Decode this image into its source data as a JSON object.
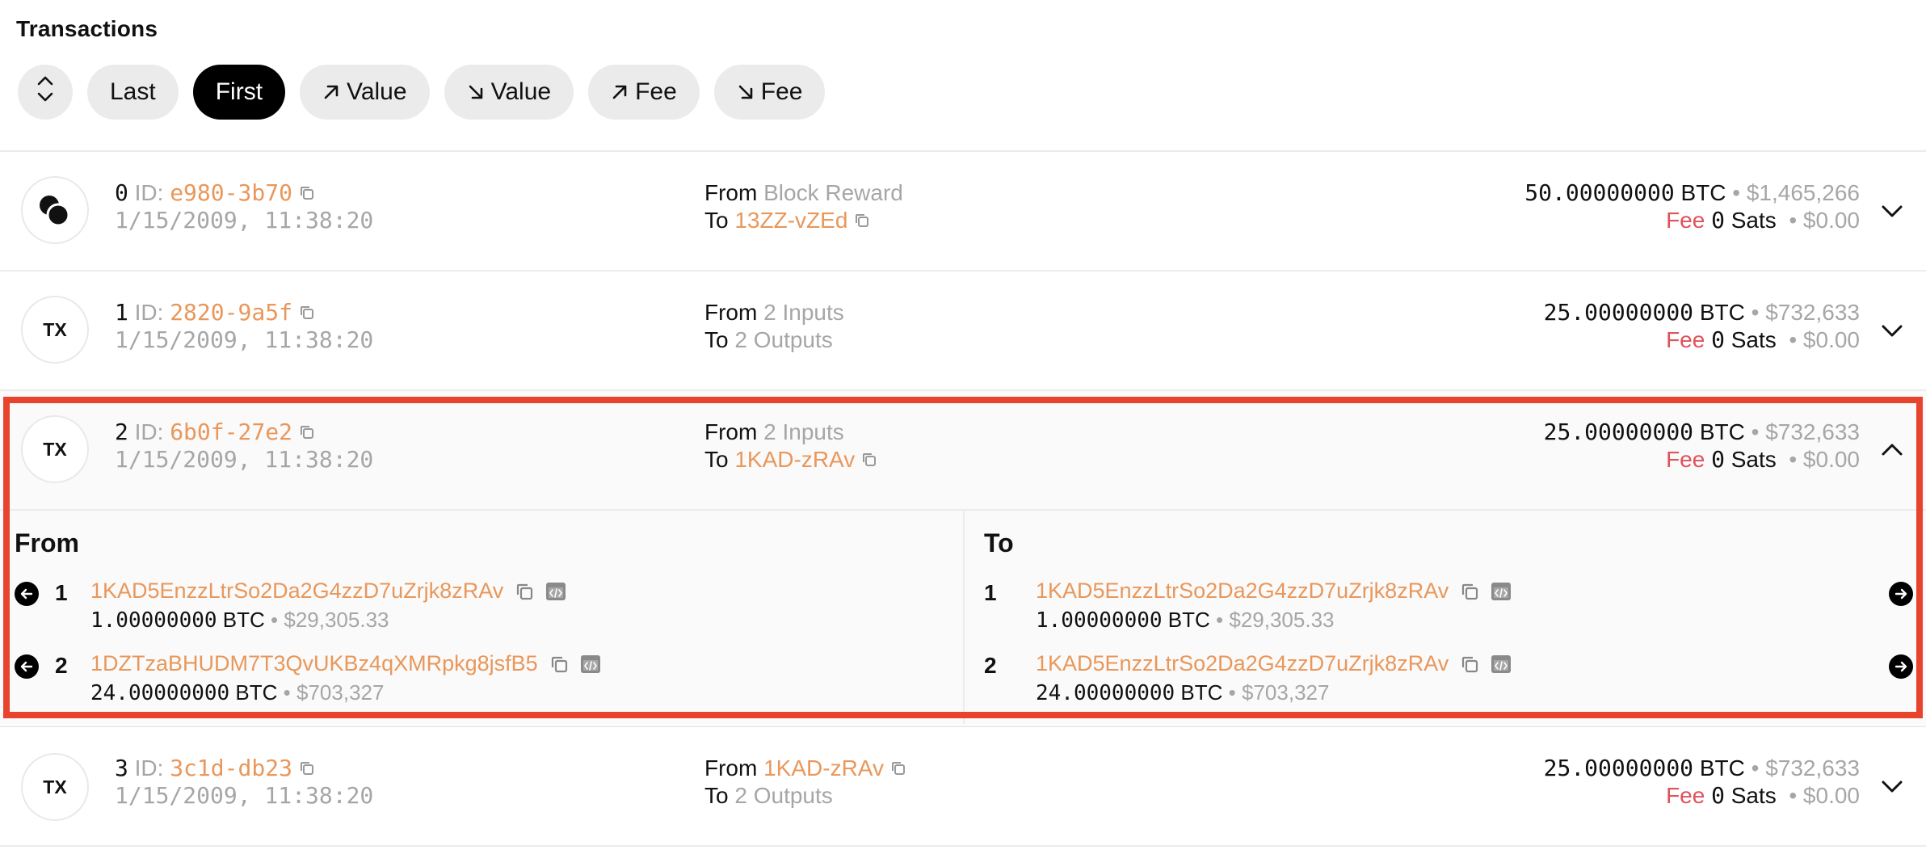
{
  "header": {
    "title": "Transactions"
  },
  "filters": {
    "sort_icon": "sort-up-down-icon",
    "buttons": [
      {
        "label": "Last",
        "active": false
      },
      {
        "label": "First",
        "active": true
      },
      {
        "label": "Value",
        "icon": "arrow-up-right-icon"
      },
      {
        "label": "Value",
        "icon": "arrow-down-right-icon"
      },
      {
        "label": "Fee",
        "icon": "arrow-up-right-icon"
      },
      {
        "label": "Fee",
        "icon": "arrow-down-right-icon"
      }
    ]
  },
  "colors": {
    "accent_orange": "#e9975a",
    "fee_red": "#e0525a",
    "highlight": "#e8432c",
    "muted": "#a6a6a6"
  },
  "transactions": [
    {
      "index": "0",
      "id_label": "ID:",
      "id": "e980-3b70",
      "date": "1/15/2009, 11:38:20",
      "avatar": "coinbase-icon",
      "from_label": "From",
      "from": "Block Reward",
      "to_label": "To",
      "to": "13ZZ-vZEd",
      "amount": "50.00000000",
      "unit": "BTC",
      "usd": "$1,465,266",
      "fee_label": "Fee",
      "fee": "0",
      "fee_unit": "Sats",
      "fee_usd": "$0.00"
    },
    {
      "index": "1",
      "id_label": "ID:",
      "id": "2820-9a5f",
      "date": "1/15/2009, 11:38:20",
      "avatar": "TX",
      "from_label": "From",
      "from": "2 Inputs",
      "to_label": "To",
      "to": "2 Outputs",
      "amount": "25.00000000",
      "unit": "BTC",
      "usd": "$732,633",
      "fee_label": "Fee",
      "fee": "0",
      "fee_unit": "Sats",
      "fee_usd": "$0.00"
    },
    {
      "index": "2",
      "id_label": "ID:",
      "id": "6b0f-27e2",
      "date": "1/15/2009, 11:38:20",
      "avatar": "TX",
      "from_label": "From",
      "from": "2 Inputs",
      "to_label": "To",
      "to": "1KAD-zRAv",
      "amount": "25.00000000",
      "unit": "BTC",
      "usd": "$732,633",
      "fee_label": "Fee",
      "fee": "0",
      "fee_unit": "Sats",
      "fee_usd": "$0.00",
      "expanded": true
    },
    {
      "index": "3",
      "id_label": "ID:",
      "id": "3c1d-db23",
      "date": "1/15/2009, 11:38:20",
      "avatar": "TX",
      "from_label": "From",
      "from": "1KAD-zRAv",
      "to_label": "To",
      "to": "2 Outputs",
      "amount": "25.00000000",
      "unit": "BTC",
      "usd": "$732,633",
      "fee_label": "Fee",
      "fee": "0",
      "fee_unit": "Sats",
      "fee_usd": "$0.00"
    }
  ],
  "detail": {
    "from_title": "From",
    "to_title": "To",
    "inputs": [
      {
        "n": "1",
        "address": "1KAD5EnzzLtrSo2Da2G4zzD7uZrjk8zRAv",
        "amount": "1.00000000",
        "unit": "BTC",
        "usd": "$29,305.33"
      },
      {
        "n": "2",
        "address": "1DZTzaBHUDM7T3QvUKBz4qXMRpkg8jsfB5",
        "amount": "24.00000000",
        "unit": "BTC",
        "usd": "$703,327"
      }
    ],
    "outputs": [
      {
        "n": "1",
        "address": "1KAD5EnzzLtrSo2Da2G4zzD7uZrjk8zRAv",
        "amount": "1.00000000",
        "unit": "BTC",
        "usd": "$29,305.33"
      },
      {
        "n": "2",
        "address": "1KAD5EnzzLtrSo2Da2G4zzD7uZrjk8zRAv",
        "amount": "24.00000000",
        "unit": "BTC",
        "usd": "$703,327"
      }
    ]
  }
}
